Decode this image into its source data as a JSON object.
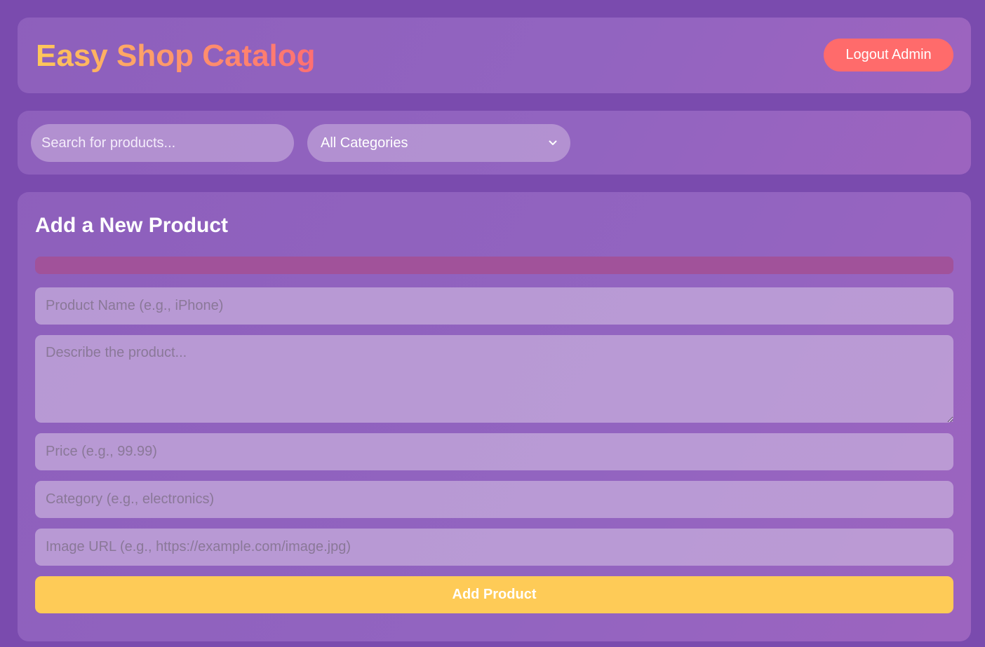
{
  "header": {
    "title": "Easy Shop Catalog",
    "logout_label": "Logout Admin"
  },
  "filters": {
    "search_placeholder": "Search for products...",
    "category_selected": "All Categories",
    "chevron_icon": "chevron-down-icon"
  },
  "form": {
    "title": "Add a New Product",
    "name_placeholder": "Product Name (e.g., iPhone)",
    "description_placeholder": "Describe the product...",
    "price_placeholder": "Price (e.g., 99.99)",
    "category_placeholder": "Category (e.g., electronics)",
    "image_placeholder": "Image URL (e.g., https://example.com/image.jpg)",
    "submit_label": "Add Product"
  },
  "colors": {
    "background": "#7a4bae",
    "accent_logout": "#ff6b6b",
    "accent_submit": "#fecb57",
    "message_bar": "#a1529a"
  }
}
